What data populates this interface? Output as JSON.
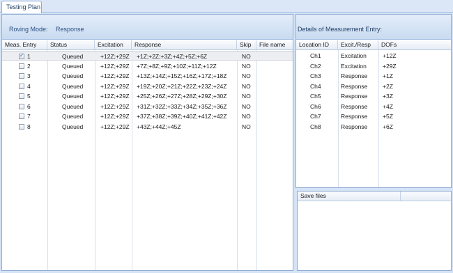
{
  "tab": {
    "label": "Testing Plan"
  },
  "roving": {
    "label": "Roving Mode:",
    "value": "Response"
  },
  "plan_table": {
    "columns": [
      "Meas. Entry",
      "Status",
      "Excitation",
      "Response",
      "Skip",
      "File name"
    ],
    "rows": [
      {
        "entry": "1",
        "checked": true,
        "status": "Queued",
        "excitation": "+12Z;+29Z",
        "response": "+1Z;+2Z;+3Z;+4Z;+5Z;+6Z",
        "skip": "NO",
        "file": ""
      },
      {
        "entry": "2",
        "checked": false,
        "status": "Queued",
        "excitation": "+12Z;+29Z",
        "response": "+7Z;+8Z;+9Z;+10Z;+11Z;+12Z",
        "skip": "NO",
        "file": ""
      },
      {
        "entry": "3",
        "checked": false,
        "status": "Queued",
        "excitation": "+12Z;+29Z",
        "response": "+13Z;+14Z;+15Z;+16Z;+17Z;+18Z",
        "skip": "NO",
        "file": ""
      },
      {
        "entry": "4",
        "checked": false,
        "status": "Queued",
        "excitation": "+12Z;+29Z",
        "response": "+19Z;+20Z;+21Z;+22Z;+23Z;+24Z",
        "skip": "NO",
        "file": ""
      },
      {
        "entry": "5",
        "checked": false,
        "status": "Queued",
        "excitation": "+12Z;+29Z",
        "response": "+25Z;+26Z;+27Z;+28Z;+29Z;+30Z",
        "skip": "NO",
        "file": ""
      },
      {
        "entry": "6",
        "checked": false,
        "status": "Queued",
        "excitation": "+12Z;+29Z",
        "response": "+31Z;+32Z;+33Z;+34Z;+35Z;+36Z",
        "skip": "NO",
        "file": ""
      },
      {
        "entry": "7",
        "checked": false,
        "status": "Queued",
        "excitation": "+12Z;+29Z",
        "response": "+37Z;+38Z;+39Z;+40Z;+41Z;+42Z",
        "skip": "NO",
        "file": ""
      },
      {
        "entry": "8",
        "checked": false,
        "status": "Queued",
        "excitation": "+12Z;+29Z",
        "response": "+43Z;+44Z;+45Z",
        "skip": "NO",
        "file": ""
      }
    ]
  },
  "details": {
    "title": "Details of Measurement Entry:",
    "columns": [
      "Location ID",
      "Excit./Resp",
      "DOFs"
    ],
    "rows": [
      {
        "location": "Ch1",
        "type": "Excitation",
        "dof": "+12Z"
      },
      {
        "location": "Ch2",
        "type": "Excitation",
        "dof": "+29Z"
      },
      {
        "location": "Ch3",
        "type": "Response",
        "dof": "+1Z"
      },
      {
        "location": "Ch4",
        "type": "Response",
        "dof": "+2Z"
      },
      {
        "location": "Ch5",
        "type": "Response",
        "dof": "+3Z"
      },
      {
        "location": "Ch6",
        "type": "Response",
        "dof": "+4Z"
      },
      {
        "location": "Ch7",
        "type": "Response",
        "dof": "+5Z"
      },
      {
        "location": "Ch8",
        "type": "Response",
        "dof": "+6Z"
      }
    ]
  },
  "save_files": {
    "header": "Save files"
  }
}
